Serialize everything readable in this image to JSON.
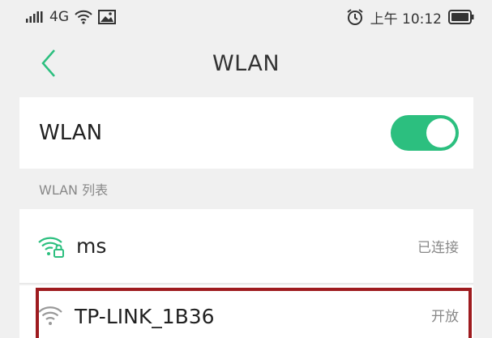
{
  "status_bar": {
    "signal": "ıııll",
    "network": "4G",
    "time": "上午 10:12"
  },
  "nav": {
    "title": "WLAN"
  },
  "wlan_toggle": {
    "label": "WLAN",
    "state": "on"
  },
  "list": {
    "header": "WLAN 列表",
    "networks": [
      {
        "name": "ms",
        "status": "已连接",
        "secured": true
      },
      {
        "name": "TP-LINK_1B36",
        "status": "开放",
        "secured": false
      }
    ]
  },
  "colors": {
    "accent": "#2cbf7f",
    "highlight": "#9e1b1f"
  }
}
